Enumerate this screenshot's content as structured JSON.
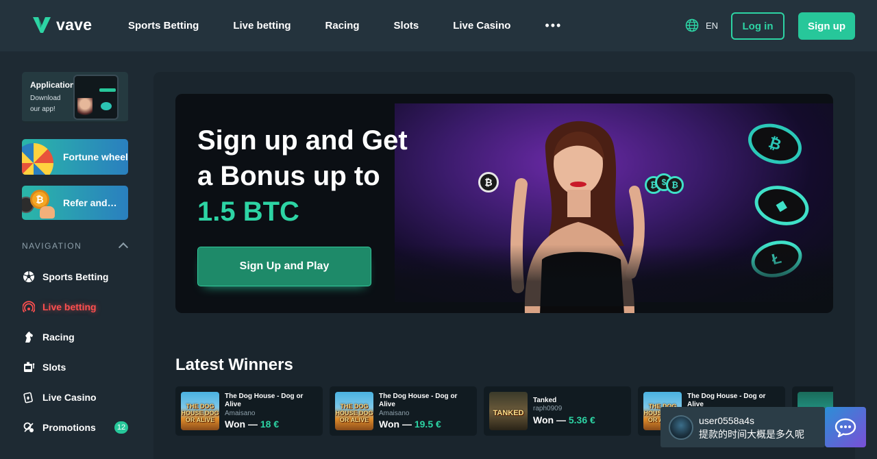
{
  "header": {
    "logo_text": "vave",
    "nav": [
      "Sports Betting",
      "Live betting",
      "Racing",
      "Slots",
      "Live Casino"
    ],
    "more": "•••",
    "lang": "EN",
    "login": "Log in",
    "signup": "Sign up"
  },
  "sidebar": {
    "app_promo": {
      "title": "Application",
      "subtitle": "Download our app!"
    },
    "fortune": "Fortune wheel",
    "refer": "Refer and…",
    "nav_heading": "NAVIGATION",
    "items": [
      {
        "label": "Sports Betting",
        "icon": "soccer-ball-icon"
      },
      {
        "label": "Live betting",
        "icon": "live-signal-icon",
        "active": true
      },
      {
        "label": "Racing",
        "icon": "horse-icon"
      },
      {
        "label": "Slots",
        "icon": "slot-machine-icon"
      },
      {
        "label": "Live Casino",
        "icon": "cards-icon"
      },
      {
        "label": "Promotions",
        "icon": "promo-icon",
        "badge": "12"
      }
    ]
  },
  "hero": {
    "line1": "Sign up and Get",
    "line2": "a Bonus up to",
    "accent": "1.5 BTC",
    "cta": "Sign Up and Play"
  },
  "winners": {
    "title": "Latest Winners",
    "won_prefix": "Won —",
    "items": [
      {
        "game": "The Dog House - Dog or Alive",
        "user": "Amaisano",
        "amount": "18 €",
        "thumb": "dog",
        "thumb_text": "THE DOG HOUSE DOG OR ALIVE"
      },
      {
        "game": "The Dog House - Dog or Alive",
        "user": "Amaisano",
        "amount": "19.5 €",
        "thumb": "dog",
        "thumb_text": "THE DOG HOUSE DOG OR ALIVE"
      },
      {
        "game": "Tanked",
        "user": "raph0909",
        "amount": "5.36 €",
        "thumb": "tank",
        "thumb_text": "TANKED"
      },
      {
        "game": "The Dog House - Dog or Alive",
        "user": "",
        "amount": "",
        "thumb": "dog",
        "thumb_text": "THE DOG HOUSE DOG OR ALIVE"
      }
    ]
  },
  "chat": {
    "user": "user0558a4s",
    "message": "提款的时间大概是多久呢"
  },
  "colors": {
    "accent": "#2dd4a4",
    "active": "#ff4f4f",
    "background": "#1e2a33"
  }
}
